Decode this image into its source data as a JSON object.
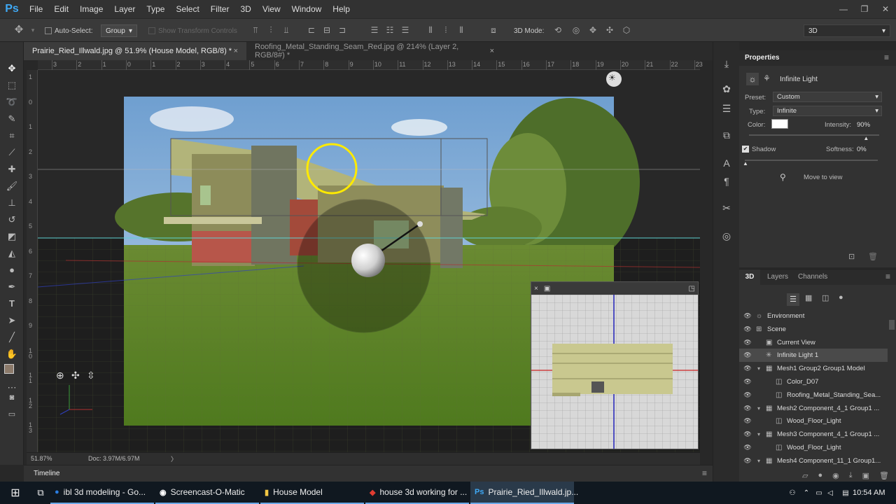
{
  "menubar": {
    "logo": "Ps",
    "items": [
      "File",
      "Edit",
      "Image",
      "Layer",
      "Type",
      "Select",
      "Filter",
      "3D",
      "View",
      "Window",
      "Help"
    ],
    "win_min": "—",
    "win_max": "❐",
    "win_close": "✕"
  },
  "options": {
    "auto_select_label": "Auto-Select:",
    "auto_select_value": "Group",
    "show_transform_label": "Show Transform Controls",
    "mode_label": "3D Mode:",
    "workspace": "3D"
  },
  "tabs": [
    {
      "label": "Prairie_Ried_Illwald.jpg @ 51.9% (House Model, RGB/8) *",
      "close": "×"
    },
    {
      "label": "Roofing_Metal_Standing_Seam_Red.jpg @ 214% (Layer 2, RGB/8#) *",
      "close": "×"
    }
  ],
  "ruler": {
    "h_ticks": [
      "3",
      "2",
      "1",
      "0",
      "1",
      "2",
      "3",
      "4",
      "5",
      "6",
      "7",
      "8",
      "9",
      "10",
      "11",
      "12",
      "13",
      "14",
      "15",
      "16",
      "17",
      "18",
      "19",
      "20",
      "21",
      "22",
      "23"
    ],
    "v_ticks": [
      "1",
      "0",
      "1",
      "2",
      "3",
      "4",
      "5",
      "6",
      "7",
      "8",
      "9",
      "1\n0",
      "1\n1",
      "1\n2",
      "1\n3"
    ]
  },
  "status": {
    "zoom": "51.87%",
    "doc": "Doc: 3.97M/6.97M",
    "arrow": "〉"
  },
  "timeline": {
    "label": "Timeline"
  },
  "properties": {
    "title": "Properties",
    "light_name": "Infinite Light",
    "preset_label": "Preset:",
    "preset_value": "Custom",
    "type_label": "Type:",
    "type_value": "Infinite",
    "color_label": "Color:",
    "color_value": "#ffffff",
    "intensity_label": "Intensity:",
    "intensity_value": "90%",
    "intensity_level": 0.9,
    "shadow_label": "Shadow",
    "softness_label": "Softness:",
    "softness_value": "0%",
    "move_to_view": "Move to view"
  },
  "panel3d": {
    "tabs": [
      "3D",
      "Layers",
      "Channels"
    ],
    "rows": [
      {
        "label": "Environment",
        "indent": 0,
        "icon": "☼",
        "eye": true
      },
      {
        "label": "Scene",
        "indent": 0,
        "icon": "⊞",
        "eye": true
      },
      {
        "label": "Current View",
        "indent": 1,
        "icon": "▣",
        "eye": true
      },
      {
        "label": "Infinite Light 1",
        "indent": 1,
        "icon": "✳",
        "eye": true,
        "selected": true
      },
      {
        "label": "Mesh1 Group2 Group1 Model",
        "indent": 1,
        "icon": "▦",
        "eye": true,
        "toggle": true
      },
      {
        "label": "Color_D07",
        "indent": 2,
        "icon": "◫",
        "eye": true
      },
      {
        "label": "Roofing_Metal_Standing_Sea...",
        "indent": 2,
        "icon": "◫",
        "eye": true
      },
      {
        "label": "Mesh2 Component_4_1 Group1 ...",
        "indent": 1,
        "icon": "▦",
        "eye": true,
        "toggle": true
      },
      {
        "label": "Wood_Floor_Light",
        "indent": 2,
        "icon": "◫",
        "eye": true
      },
      {
        "label": "Mesh3 Component_4_1 Group1 ...",
        "indent": 1,
        "icon": "▦",
        "eye": true,
        "toggle": true
      },
      {
        "label": "Wood_Floor_Light",
        "indent": 2,
        "icon": "◫",
        "eye": true
      },
      {
        "label": "Mesh4 Component_11_1 Group1...",
        "indent": 1,
        "icon": "▦",
        "eye": true,
        "toggle": true
      }
    ]
  },
  "taskbar": {
    "items": [
      {
        "label": "ibl 3d modeling - Go...",
        "icon": "●",
        "color": "#2a7de1"
      },
      {
        "label": "Screencast-O-Matic",
        "icon": "◉",
        "color": "#ffffff"
      },
      {
        "label": "House Model",
        "icon": "▮",
        "color": "#f2c744"
      },
      {
        "label": "house 3d working for ...",
        "icon": "◆",
        "color": "#e03c31"
      },
      {
        "label": "Prairie_Ried_Illwald.jp...",
        "icon": "Ps",
        "color": "#3fa9f5"
      }
    ],
    "time": "10:54 AM"
  }
}
